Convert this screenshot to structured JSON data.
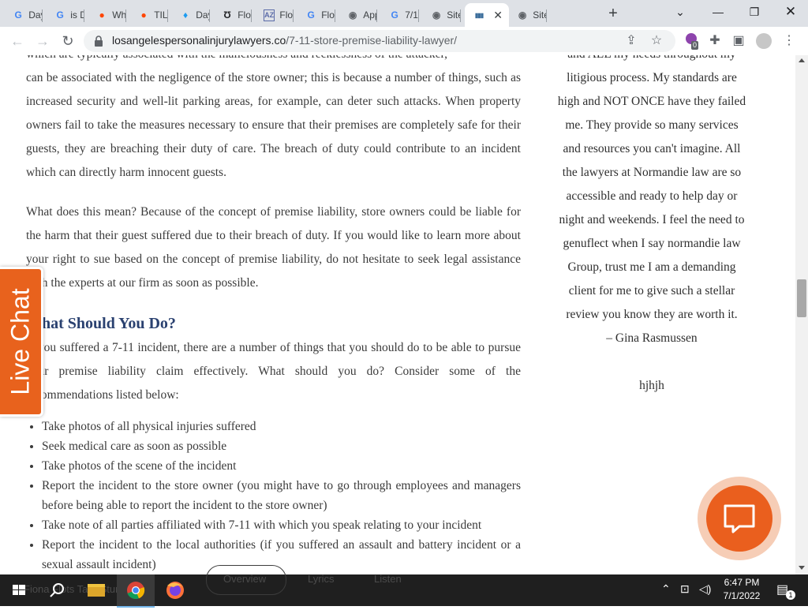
{
  "browser": {
    "tabs": [
      {
        "icon": "google-icon",
        "glyph": "G",
        "color": "#4285f4",
        "title": "Day"
      },
      {
        "icon": "google-icon",
        "glyph": "G",
        "color": "#4285f4",
        "title": "is D"
      },
      {
        "icon": "reddit-icon",
        "glyph": "●",
        "color": "#ff4500",
        "title": "Wh"
      },
      {
        "icon": "reddit-icon",
        "glyph": "●",
        "color": "#ff4500",
        "title": "TIL"
      },
      {
        "icon": "twitter-icon",
        "glyph": "♦",
        "color": "#1d9bf0",
        "title": "Day"
      },
      {
        "icon": "site-icon",
        "glyph": "Ʊ",
        "color": "#202124",
        "title": "Flo"
      },
      {
        "icon": "az-icon",
        "glyph": "AZ",
        "color": "#5b6ba8",
        "title": "Flo"
      },
      {
        "icon": "google-icon",
        "glyph": "G",
        "color": "#4285f4",
        "title": "Flo"
      },
      {
        "icon": "globe-icon",
        "glyph": "◉",
        "color": "#5f6368",
        "title": "App"
      },
      {
        "icon": "google-icon",
        "glyph": "G",
        "color": "#4285f4",
        "title": "7/1"
      },
      {
        "icon": "globe-icon",
        "glyph": "◉",
        "color": "#5f6368",
        "title": "Site"
      },
      {
        "icon": "bars-icon",
        "glyph": "▮▮▮",
        "color": "#3c6e9c",
        "title": "",
        "active": true
      },
      {
        "icon": "globe-icon",
        "glyph": "◉",
        "color": "#5f6368",
        "title": "Site"
      }
    ],
    "url_host": "losangelespersonalinjurylawyers.co",
    "url_path": "/7-11-store-premise-liability-lawyer/",
    "extension_badge": "0"
  },
  "article": {
    "para1_top": "which are typically associated with the maliciousness and recklessness of the attacker,",
    "para1": "can be associated with the negligence of the store owner; this is because a number of things, such as increased security and well-lit parking areas, for example, can deter such attacks. When property owners fail to take the measures necessary to ensure that their premises are completely safe for their guests, they are breaching their duty of care. The breach of duty could contribute to an incident which can directly harm innocent guests.",
    "para2": "What does this mean? Because of the concept of premise liability, store owners could be liable for the harm that their guest suffered due to their breach of duty. If you would like to learn more about your right to sue based on the concept of premise liability, do not hesitate to seek legal assistance with the experts at our firm as soon as possible.",
    "heading": "What Should You Do?",
    "para3": "If you suffered a 7-11 incident, there are a number of things that you should do to be able to pursue your premise liability claim effectively. What should you do? Consider some of the recommendations listed below:",
    "recommendations": [
      "Take photos of all physical injuries suffered",
      "Seek medical care as soon as possible",
      "Take photos of the scene of the incident",
      "Report the incident to the store owner (you might have to go through employees and managers before being able to report the incident to the store owner)",
      "Take note of all parties affiliated with 7-11 with which you speak relating to your incident",
      "Report the incident to the local authorities (if you suffered an assault and battery incident or a sexual assault incident)"
    ]
  },
  "testimonial": {
    "text": "and ALL my needs throughout my litigious process. My standards are high and NOT ONCE have they failed me. They provide so many services and resources you can't imagine. All the lawyers at Normandie law are so accessible and ready to help day or night and weekends. I feel the need to genuflect when I say normandie law Group, trust me I am a demanding client for me to give such a stellar review you know they are worth it.",
    "author": "– Gina Rasmussen",
    "extra": "hjhjh"
  },
  "live_chat_label": "Live Chat",
  "taskbar": {
    "ghost_text_left": "Fiona Flots Tarp Stunning",
    "ghost_overview": "Overview",
    "ghost_lyrics": "Lyrics",
    "ghost_listen": "Listen",
    "time": "6:47 PM",
    "date": "7/1/2022",
    "notification_count": "1"
  },
  "colors": {
    "accent_orange": "#ea5f1e",
    "heading_blue": "#2a4170",
    "tabstrip_gray": "#dee1e6"
  }
}
